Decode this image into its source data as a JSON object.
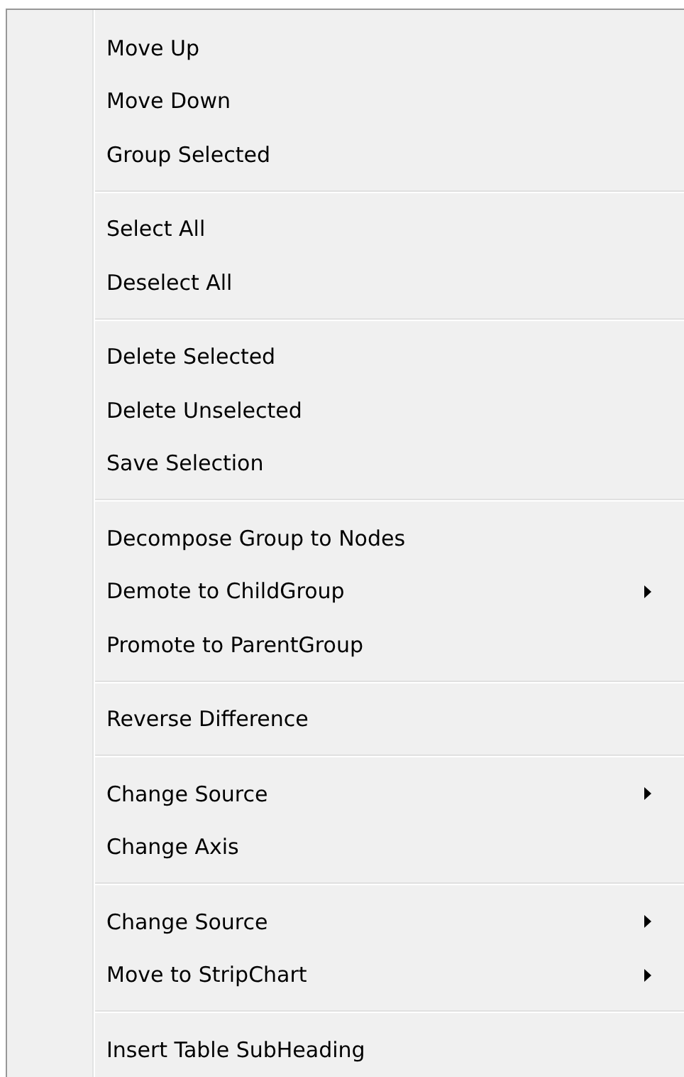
{
  "menu": {
    "groups": [
      {
        "items": [
          {
            "label": "Move Up",
            "submenu": false
          },
          {
            "label": "Move Down",
            "submenu": false
          },
          {
            "label": "Group Selected",
            "submenu": false
          }
        ]
      },
      {
        "items": [
          {
            "label": "Select All",
            "submenu": false
          },
          {
            "label": "Deselect All",
            "submenu": false
          }
        ]
      },
      {
        "items": [
          {
            "label": "Delete Selected",
            "submenu": false
          },
          {
            "label": "Delete Unselected",
            "submenu": false
          },
          {
            "label": "Save Selection",
            "submenu": false
          }
        ]
      },
      {
        "items": [
          {
            "label": "Decompose Group to Nodes",
            "submenu": false
          },
          {
            "label": "Demote to ChildGroup",
            "submenu": true
          },
          {
            "label": "Promote to ParentGroup",
            "submenu": false
          }
        ]
      },
      {
        "items": [
          {
            "label": "Reverse Difference",
            "submenu": false
          }
        ]
      },
      {
        "items": [
          {
            "label": "Change Source",
            "submenu": true
          },
          {
            "label": "Change Axis",
            "submenu": false
          }
        ]
      },
      {
        "items": [
          {
            "label": "Change Source",
            "submenu": true
          },
          {
            "label": "Move to StripChart",
            "submenu": true
          }
        ]
      },
      {
        "items": [
          {
            "label": "Insert Table SubHeading",
            "submenu": false
          }
        ]
      }
    ]
  }
}
